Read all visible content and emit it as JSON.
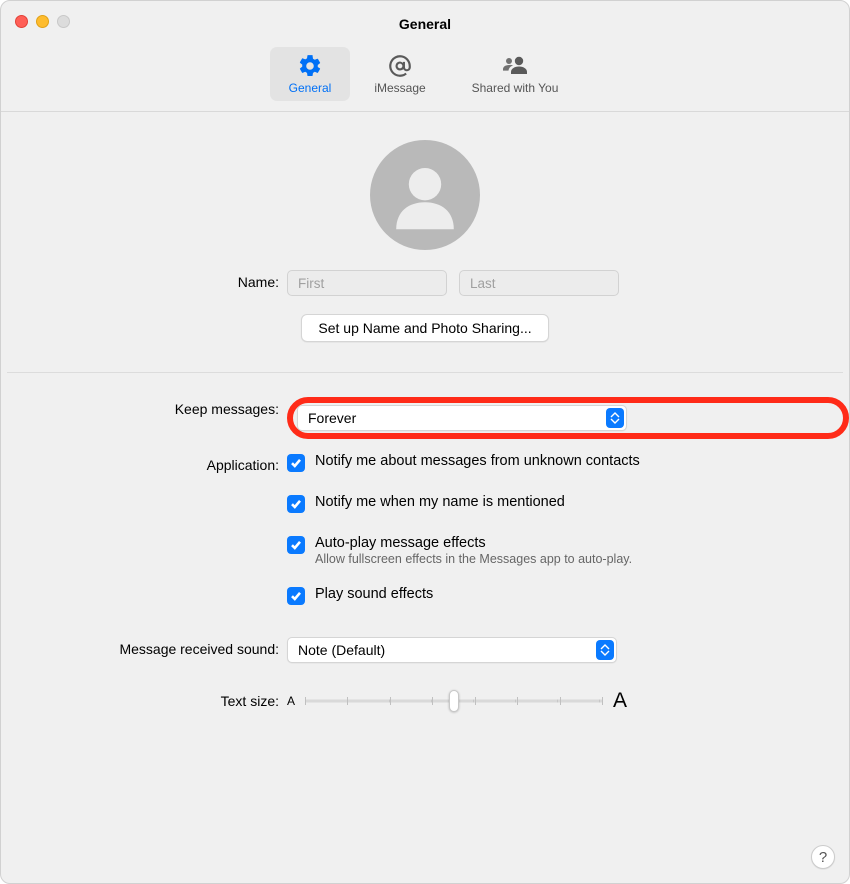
{
  "window": {
    "title": "General"
  },
  "tabs": {
    "general": "General",
    "imessage": "iMessage",
    "shared": "Shared with You"
  },
  "labels": {
    "name": "Name:",
    "keep": "Keep messages:",
    "application": "Application:",
    "sound": "Message received sound:",
    "textsize": "Text size:"
  },
  "name_fields": {
    "first_placeholder": "First",
    "last_placeholder": "Last"
  },
  "buttons": {
    "setup": "Set up Name and Photo Sharing..."
  },
  "keep_select": {
    "value": "Forever"
  },
  "checks": {
    "unknown": "Notify me about messages from unknown contacts",
    "mention": "Notify me when my name is mentioned",
    "autoplay": "Auto-play message effects",
    "autoplay_sub": "Allow fullscreen effects in the Messages app to auto-play.",
    "sound_effects": "Play sound effects"
  },
  "sound_select": {
    "value": "Note (Default)"
  },
  "slider": {
    "small": "A",
    "big": "A",
    "ticks": 8,
    "position_pct": 50
  },
  "help": "?"
}
